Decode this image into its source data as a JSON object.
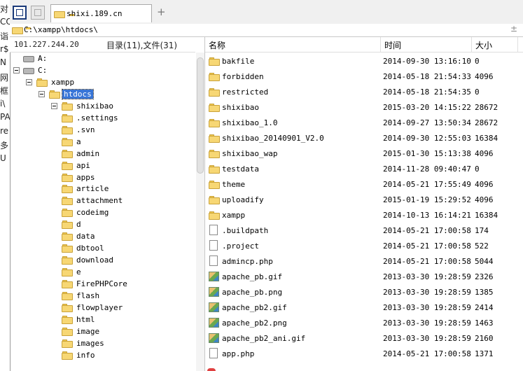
{
  "left_strip": [
    "对",
    "CQ",
    "诣",
    "r$",
    "N",
    "网",
    "框",
    "i\\",
    "PA",
    "re",
    "多",
    "U"
  ],
  "tab": {
    "title": "shixi.189.cn"
  },
  "address": {
    "path": "C:\\xampp\\htdocs\\"
  },
  "left_pane": {
    "ip": "101.227.244.20",
    "counts": "目录(11),文件(31)"
  },
  "tree": [
    {
      "label": "A:",
      "level": 0,
      "icon": "drive-icon",
      "expanded": false
    },
    {
      "label": "C:",
      "level": 0,
      "icon": "drive-icon",
      "expanded": true
    },
    {
      "label": "xampp",
      "level": 1,
      "icon": "folder-icon",
      "expanded": true
    },
    {
      "label": "htdocs",
      "level": 2,
      "icon": "folder-icon",
      "expanded": true,
      "selected": true
    },
    {
      "label": "shixibao",
      "level": 3,
      "icon": "folder-icon",
      "expanded": true
    },
    {
      "label": ".settings",
      "level": 4,
      "icon": "folder-icon"
    },
    {
      "label": ".svn",
      "level": 4,
      "icon": "folder-icon"
    },
    {
      "label": "a",
      "level": 4,
      "icon": "folder-icon"
    },
    {
      "label": "admin",
      "level": 4,
      "icon": "folder-icon"
    },
    {
      "label": "api",
      "level": 4,
      "icon": "folder-icon"
    },
    {
      "label": "apps",
      "level": 4,
      "icon": "folder-icon"
    },
    {
      "label": "article",
      "level": 4,
      "icon": "folder-icon"
    },
    {
      "label": "attachment",
      "level": 4,
      "icon": "folder-icon"
    },
    {
      "label": "codeimg",
      "level": 4,
      "icon": "folder-icon"
    },
    {
      "label": "d",
      "level": 4,
      "icon": "folder-icon"
    },
    {
      "label": "data",
      "level": 4,
      "icon": "folder-icon"
    },
    {
      "label": "dbtool",
      "level": 4,
      "icon": "folder-icon"
    },
    {
      "label": "download",
      "level": 4,
      "icon": "folder-icon"
    },
    {
      "label": "e",
      "level": 4,
      "icon": "folder-icon"
    },
    {
      "label": "FirePHPCore",
      "level": 4,
      "icon": "folder-icon"
    },
    {
      "label": "flash",
      "level": 4,
      "icon": "folder-icon"
    },
    {
      "label": "flowplayer",
      "level": 4,
      "icon": "folder-icon"
    },
    {
      "label": "html",
      "level": 4,
      "icon": "folder-icon"
    },
    {
      "label": "image",
      "level": 4,
      "icon": "folder-icon"
    },
    {
      "label": "images",
      "level": 4,
      "icon": "folder-icon"
    },
    {
      "label": "info",
      "level": 4,
      "icon": "folder-icon"
    }
  ],
  "columns": {
    "name": "名称",
    "time": "时间",
    "size": "大小"
  },
  "files": [
    {
      "name": "bakfile",
      "time": "2014-09-30 13:16:10",
      "size": "0",
      "icon": "folder-icon"
    },
    {
      "name": "forbidden",
      "time": "2014-05-18 21:54:33",
      "size": "4096",
      "icon": "folder-icon"
    },
    {
      "name": "restricted",
      "time": "2014-05-18 21:54:35",
      "size": "0",
      "icon": "folder-icon"
    },
    {
      "name": "shixibao",
      "time": "2015-03-20 14:15:22",
      "size": "28672",
      "icon": "folder-icon"
    },
    {
      "name": "shixibao_1.0",
      "time": "2014-09-27 13:50:34",
      "size": "28672",
      "icon": "folder-icon"
    },
    {
      "name": "shixibao_20140901_V2.0",
      "time": "2014-09-30 12:55:03",
      "size": "16384",
      "icon": "folder-icon"
    },
    {
      "name": "shixibao_wap",
      "time": "2015-01-30 15:13:38",
      "size": "4096",
      "icon": "folder-icon"
    },
    {
      "name": "testdata",
      "time": "2014-11-28 09:40:47",
      "size": "0",
      "icon": "folder-icon"
    },
    {
      "name": "theme",
      "time": "2014-05-21 17:55:49",
      "size": "4096",
      "icon": "folder-icon"
    },
    {
      "name": "uploadify",
      "time": "2015-01-19 15:29:52",
      "size": "4096",
      "icon": "folder-icon"
    },
    {
      "name": "xampp",
      "time": "2014-10-13 16:14:21",
      "size": "16384",
      "icon": "folder-icon"
    },
    {
      "name": ".buildpath",
      "time": "2014-05-21 17:00:58",
      "size": "174",
      "icon": "file-icon"
    },
    {
      "name": ".project",
      "time": "2014-05-21 17:00:58",
      "size": "522",
      "icon": "file-icon"
    },
    {
      "name": "admincp.php",
      "time": "2014-05-21 17:00:58",
      "size": "5044",
      "icon": "file-icon"
    },
    {
      "name": "apache_pb.gif",
      "time": "2013-03-30 19:28:59",
      "size": "2326",
      "icon": "image-icon"
    },
    {
      "name": "apache_pb.png",
      "time": "2013-03-30 19:28:59",
      "size": "1385",
      "icon": "image-icon"
    },
    {
      "name": "apache_pb2.gif",
      "time": "2013-03-30 19:28:59",
      "size": "2414",
      "icon": "image-icon"
    },
    {
      "name": "apache_pb2.png",
      "time": "2013-03-30 19:28:59",
      "size": "1463",
      "icon": "image-icon"
    },
    {
      "name": "apache_pb2_ani.gif",
      "time": "2013-03-30 19:28:59",
      "size": "2160",
      "icon": "image-icon"
    },
    {
      "name": "app.php",
      "time": "2014-05-21 17:00:58",
      "size": "1371",
      "icon": "file-icon"
    }
  ]
}
